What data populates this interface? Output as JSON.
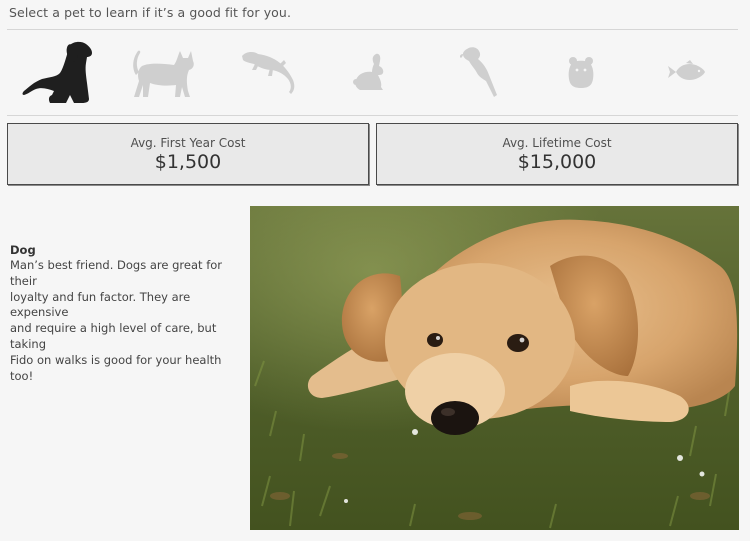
{
  "prompt": "Select a pet to learn if it’s a good fit for you.",
  "pets": [
    {
      "id": "dog",
      "icon": "dog-icon",
      "selected": true
    },
    {
      "id": "cat",
      "icon": "cat-icon",
      "selected": false
    },
    {
      "id": "lizard",
      "icon": "lizard-icon",
      "selected": false
    },
    {
      "id": "rabbit",
      "icon": "rabbit-icon",
      "selected": false
    },
    {
      "id": "parrot",
      "icon": "parrot-icon",
      "selected": false
    },
    {
      "id": "hamster",
      "icon": "hamster-icon",
      "selected": false
    },
    {
      "id": "fish",
      "icon": "fish-icon",
      "selected": false
    }
  ],
  "cost": {
    "first_year_label": "Avg. First Year Cost",
    "first_year_value": "$1,500",
    "lifetime_label": "Avg. Lifetime Cost",
    "lifetime_value": "$15,000"
  },
  "detail": {
    "name": "Dog",
    "lines": [
      "Man’s best friend. Dogs are great for their",
      "loyalty and fun factor. They are expensive",
      "and require a high level of care, but taking",
      "Fido on walks is good for your health too!"
    ]
  },
  "colors": {
    "selected_icon": "#1f1f1f",
    "unselected_icon": "#cfcfcf",
    "card_bg": "#e9e9e9"
  }
}
